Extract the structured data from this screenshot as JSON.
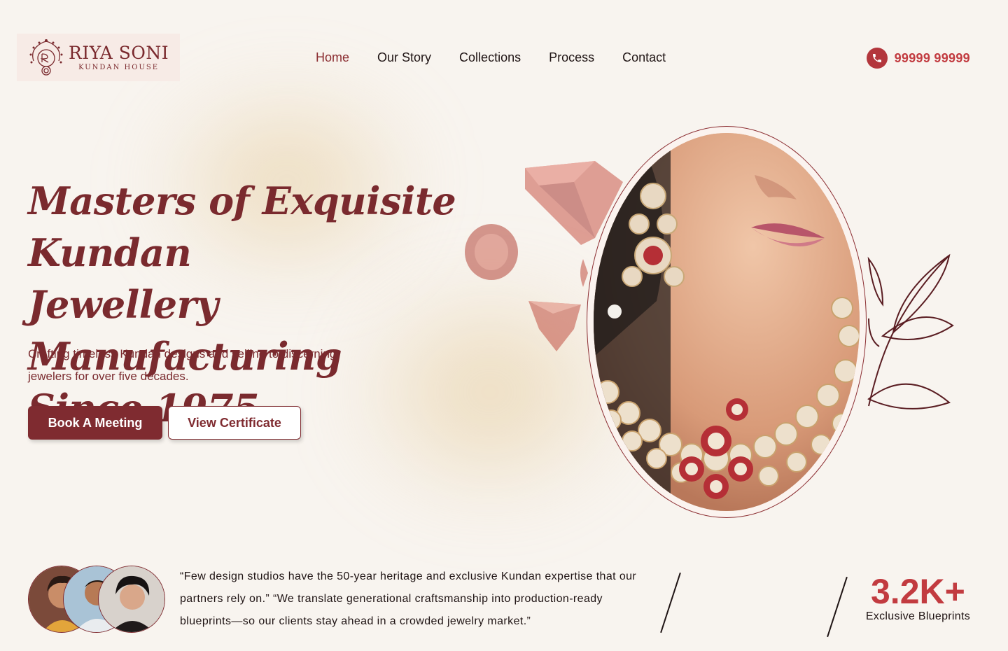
{
  "brand": {
    "name": "RIYA SONI",
    "subtitle": "KUNDAN HOUSE"
  },
  "nav": {
    "items": [
      {
        "label": "Home",
        "active": true
      },
      {
        "label": "Our Story",
        "active": false
      },
      {
        "label": "Collections",
        "active": false
      },
      {
        "label": "Process",
        "active": false
      },
      {
        "label": "Contact",
        "active": false
      }
    ]
  },
  "contact": {
    "phone": "99999 99999",
    "icon": "phone-icon"
  },
  "hero": {
    "title_lines": [
      "Masters of Exquisite Kundan",
      "Jewellery Manufacturing",
      "Since 1975"
    ],
    "subtitle": "Crafting timeless Kundan designs and selling to discerning jewelers for over five decades.",
    "primary_button": "Book A Meeting",
    "secondary_button": "View Certificate"
  },
  "testimonial": {
    "quote": "“Few design studios have the 50-year heritage and exclusive Kundan expertise that our partners rely on.” “We translate generational craftsmanship into production-ready blueprints—so our clients stay ahead in a crowded jewelry market.”"
  },
  "stat": {
    "value": "3.2K+",
    "label": "Exclusive Blueprints"
  },
  "colors": {
    "brand": "#7f2b30",
    "accent": "#c23b40",
    "background": "#f8f4ef"
  }
}
